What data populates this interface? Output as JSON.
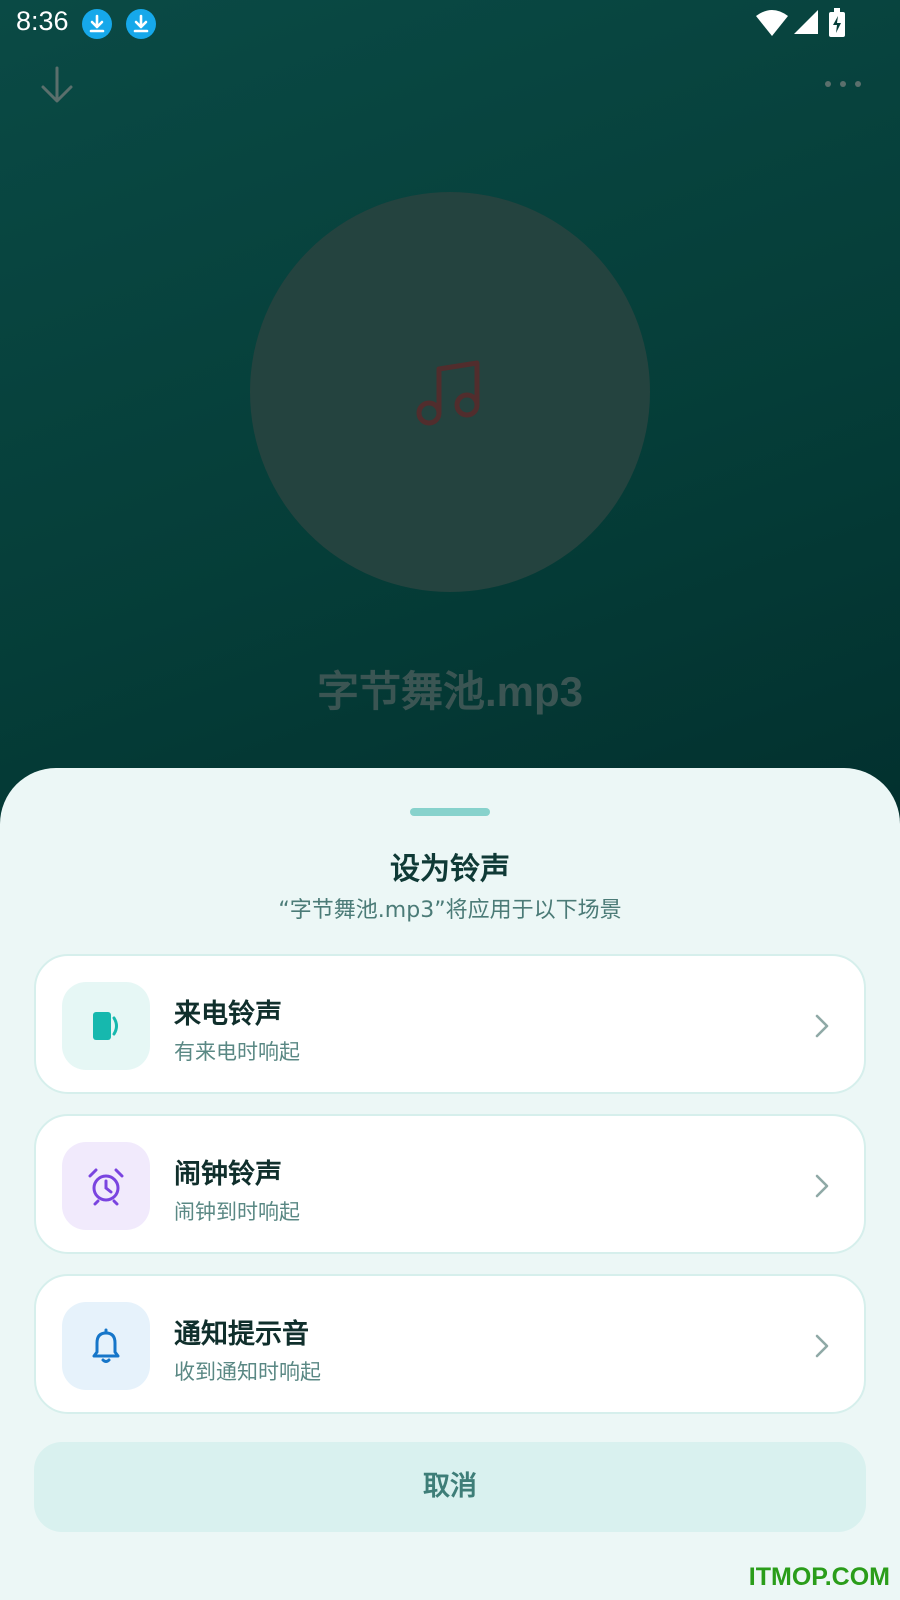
{
  "status_bar": {
    "time": "8:36",
    "notification_icons": [
      "download-icon",
      "download-icon"
    ],
    "right_icons": [
      "wifi-icon",
      "signal-icon",
      "battery-charging-icon"
    ]
  },
  "toolbar": {
    "left_icon": "arrow-down-icon",
    "right_icon": "more-icon"
  },
  "player": {
    "cover_icon": "music-note-icon",
    "track_title": "字节舞池.mp3"
  },
  "sheet": {
    "title": "设为铃声",
    "subtitle": "“字节舞池.mp3”将应用于以下场景",
    "options": [
      {
        "icon": "phone-ring-icon",
        "title": "来电铃声",
        "description": "有来电时响起",
        "icon_color": "#16b8ae",
        "icon_bg": "#e6f7f5"
      },
      {
        "icon": "alarm-clock-icon",
        "title": "闹钟铃声",
        "description": "闹钟到时响起",
        "icon_color": "#7a44e0",
        "icon_bg": "#f1eafc"
      },
      {
        "icon": "bell-icon",
        "title": "通知提示音",
        "description": "收到通知时响起",
        "icon_color": "#1676c9",
        "icon_bg": "#e6f2fb"
      }
    ],
    "cancel_label": "取消"
  },
  "watermark": "ITMOP.COM",
  "colors": {
    "accent": "#16b8ae",
    "sheet_bg": "#ecf7f6",
    "header_bg": "#053d38"
  }
}
